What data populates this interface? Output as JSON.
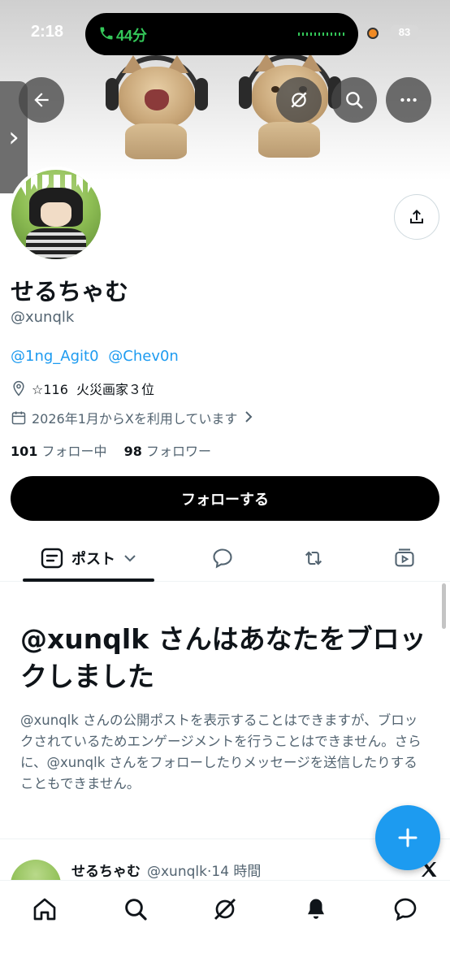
{
  "status_bar": {
    "time": "2:18",
    "call_duration": "44分",
    "battery": "83"
  },
  "profile": {
    "display_name": "せるちゃむ",
    "handle": "@xunqlk",
    "bio_mentions": [
      "@1ng_Agit0",
      "@Chev0n"
    ],
    "location": "☆116  火災画家３位",
    "joined": "2026年1月からXを利用しています",
    "following_count": "101",
    "following_label": "フォロー中",
    "followers_count": "98",
    "followers_label": "フォロワー",
    "follow_button": "フォローする"
  },
  "tabs": {
    "posts_label": "ポスト"
  },
  "blocked": {
    "title": "@xunqlk さんはあなたをブロックしました",
    "description": "@xunqlk さんの公開ポストを表示することはできますが、ブロックされているためエンゲージメントを行うことはできません。さらに、@xunqlk さんをフォローしたりメッセージを送信したりすることもできません。"
  },
  "post": {
    "name": "せるちゃむ",
    "handle": "@xunqlk",
    "separator": "·",
    "time": "14 時間"
  },
  "colors": {
    "accent": "#1d9bf0",
    "text": "#0f1419",
    "secondary": "#536471",
    "call_green": "#34c759"
  },
  "icons": {
    "back": "arrow-left-icon",
    "grok": "grok-icon",
    "search": "search-icon",
    "more": "more-icon",
    "share": "share-icon",
    "location": "location-pin-icon",
    "calendar": "calendar-icon",
    "compose": "plus-icon",
    "home": "home-icon",
    "notifications": "bell-icon",
    "messages": "message-icon"
  }
}
